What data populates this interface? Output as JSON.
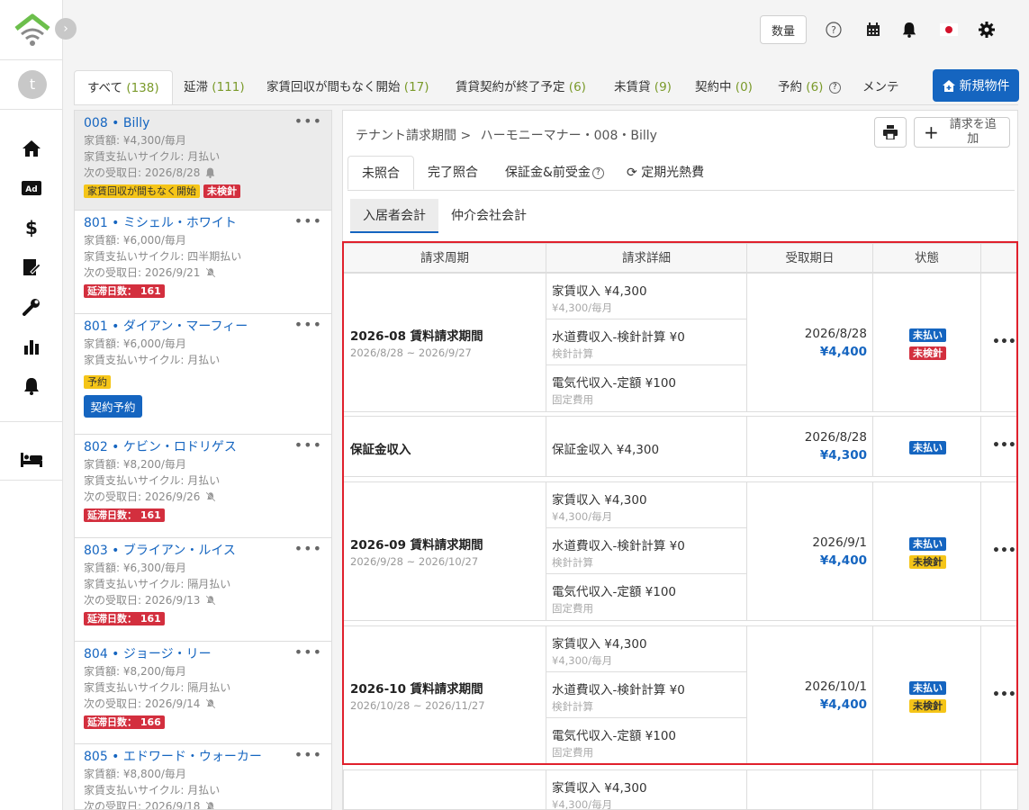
{
  "header": {
    "qty_label": "数量",
    "icons": [
      "help-icon",
      "calendar-icon",
      "bell-icon",
      "flag-japan-icon",
      "gear-icon"
    ]
  },
  "sidebar": {
    "avatar_letter": "t",
    "items": [
      "home-icon",
      "ad-icon",
      "dollar-icon",
      "contract-edit-icon",
      "wrench-icon",
      "chart-icon",
      "bell-icon",
      "bed-icon"
    ]
  },
  "tabs": [
    {
      "label": "すべて",
      "count": "(138)"
    },
    {
      "label": "延滞",
      "count": "(111)"
    },
    {
      "label": "家賃回収が間もなく開始",
      "count": "(17)"
    },
    {
      "label": "賃貸契約が終了予定",
      "count": "(6)"
    },
    {
      "label": "未賃貸",
      "count": "(9)"
    },
    {
      "label": "契約中",
      "count": "(0)"
    },
    {
      "label": "予約",
      "count": "(6)"
    },
    {
      "label": "メンテ",
      "count": ""
    }
  ],
  "new_property_label": "新規物件",
  "tenants": [
    {
      "unit": "008",
      "name": "Billy",
      "rent": "家賃額: ¥4,300/毎月",
      "cycle": "家賃支払いサイクル: 月払い",
      "next": "次の受取日:  2026/8/28",
      "badges": [
        "家賃回収が間もなく開始",
        "未検針"
      ]
    },
    {
      "unit": "801",
      "name": "ミシェル・ホワイト",
      "rent": "家賃額: ¥6,000/毎月",
      "cycle": "家賃支払いサイクル: 四半期払い",
      "next": "次の受取日:  2026/9/21",
      "badges": [
        "延滞日数： 161"
      ]
    },
    {
      "unit": "801",
      "name": "ダイアン・マーフィー",
      "rent": "家賃額: ¥6,000/毎月",
      "cycle": "家賃支払いサイクル: 月払い",
      "badges": [
        "予約"
      ],
      "button": "契約予約"
    },
    {
      "unit": "802",
      "name": "ケビン・ロドリゲス",
      "rent": "家賃額: ¥8,200/毎月",
      "cycle": "家賃支払いサイクル: 月払い",
      "next": "次の受取日:  2026/9/26",
      "badges": [
        "延滞日数： 161"
      ]
    },
    {
      "unit": "803",
      "name": "ブライアン・ルイス",
      "rent": "家賃額: ¥6,300/毎月",
      "cycle": "家賃支払いサイクル: 隔月払い",
      "next": "次の受取日:  2026/9/13",
      "badges": [
        "延滞日数： 161"
      ]
    },
    {
      "unit": "804",
      "name": "ジョージ・リー",
      "rent": "家賃額: ¥8,200/毎月",
      "cycle": "家賃支払いサイクル: 隔月払い",
      "next": "次の受取日:  2026/9/14",
      "badges": [
        "延滞日数： 166"
      ]
    },
    {
      "unit": "805",
      "name": "エドワード・ウォーカー",
      "rent": "家賃額: ¥8,800/毎月",
      "cycle": "家賃支払いサイクル: 月払い",
      "next": "次の受取日:  2026/9/18"
    }
  ],
  "main": {
    "breadcrumb_root": "テナント請求期間 >",
    "breadcrumb_current": "ハーモニーマナー・008・Billy",
    "add_bill_label": "請求を追加",
    "subtabs": [
      "未照合",
      "完了照合",
      "保証金&前受金",
      "定期光熱費"
    ],
    "account_tabs": [
      "入居者会計",
      "仲介会社会計"
    ],
    "table_headers": [
      "請求周期",
      "請求詳細",
      "受取期日",
      "状態"
    ],
    "rows": [
      {
        "cycle": "2026-08 賃料請求期間",
        "range": "2026/8/28 ~ 2026/9/27",
        "details": [
          {
            "name": "家賃収入  ¥4,300",
            "sub": "¥4,300/毎月"
          },
          {
            "name": "水道費収入-検針計算  ¥0",
            "sub": "検針計算"
          },
          {
            "name": "電気代収入-定額  ¥100",
            "sub": "固定費用"
          }
        ],
        "due": "2026/8/28",
        "amount": "¥4,400",
        "status": [
          "未払い",
          "未検針"
        ]
      },
      {
        "cycle": "保証金収入",
        "range": "",
        "details": [
          {
            "name": "保証金収入  ¥4,300",
            "sub": ""
          }
        ],
        "due": "2026/8/28",
        "amount": "¥4,300",
        "status": [
          "未払い"
        ]
      },
      {
        "cycle": "2026-09 賃料請求期間",
        "range": "2026/9/28 ~ 2026/10/27",
        "details": [
          {
            "name": "家賃収入  ¥4,300",
            "sub": "¥4,300/毎月"
          },
          {
            "name": "水道費収入-検針計算  ¥0",
            "sub": "検針計算"
          },
          {
            "name": "電気代収入-定額  ¥100",
            "sub": "固定費用"
          }
        ],
        "due": "2026/9/1",
        "amount": "¥4,400",
        "status": [
          "未払い",
          "未検針"
        ]
      },
      {
        "cycle": "2026-10 賃料請求期間",
        "range": "2026/10/28 ~ 2026/11/27",
        "details": [
          {
            "name": "家賃収入  ¥4,300",
            "sub": "¥4,300/毎月"
          },
          {
            "name": "水道費収入-検針計算  ¥0",
            "sub": "検針計算"
          },
          {
            "name": "電気代収入-定額  ¥100",
            "sub": "固定費用"
          }
        ],
        "due": "2026/10/1",
        "amount": "¥4,400",
        "status": [
          "未払い",
          "未検針"
        ]
      },
      {
        "cycle": "",
        "range": "",
        "details": [
          {
            "name": "家賃収入  ¥4,300",
            "sub": "¥4,300/毎月"
          }
        ],
        "due": "",
        "amount": "",
        "status": []
      }
    ]
  },
  "colors": {
    "accent": "#1565c0",
    "late": "#d32f3e",
    "warning": "#f5c518",
    "highlight": "#e0202c",
    "count": "#7a9a2a"
  }
}
